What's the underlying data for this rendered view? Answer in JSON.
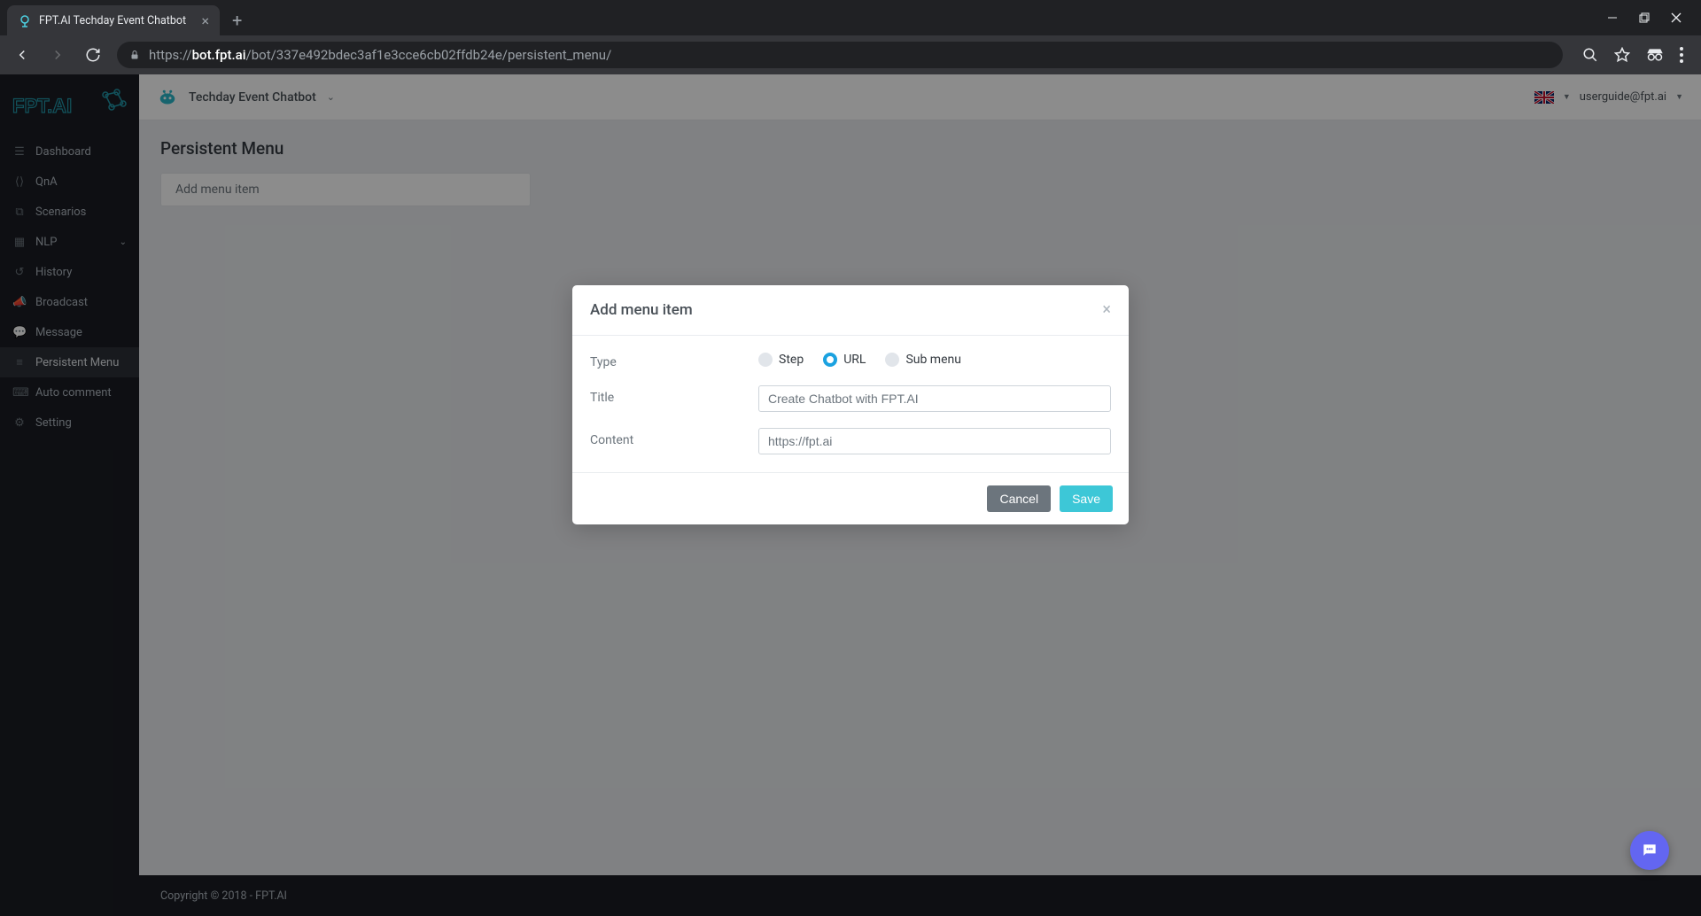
{
  "browser": {
    "tab_title": "FPT.AI Techday Event Chatbot",
    "url_scheme": "https://",
    "url_host": "bot.fpt.ai",
    "url_path": "/bot/337e492bdec3af1e3cce6cb02ffdb24e/persistent_menu/"
  },
  "sidebar": {
    "items": [
      {
        "label": "Dashboard"
      },
      {
        "label": "QnA"
      },
      {
        "label": "Scenarios"
      },
      {
        "label": "NLP"
      },
      {
        "label": "History"
      },
      {
        "label": "Broadcast"
      },
      {
        "label": "Message"
      },
      {
        "label": "Persistent Menu"
      },
      {
        "label": "Auto comment"
      },
      {
        "label": "Setting"
      }
    ]
  },
  "topbar": {
    "bot_name": "Techday Event Chatbot",
    "user_email": "userguide@fpt.ai"
  },
  "page": {
    "title": "Persistent Menu",
    "add_menu_placeholder": "Add menu item"
  },
  "modal": {
    "title": "Add menu item",
    "type_label": "Type",
    "title_label": "Title",
    "content_label": "Content",
    "radio_step": "Step",
    "radio_url": "URL",
    "radio_submenu": "Sub menu",
    "title_value": "Create Chatbot with FPT.AI",
    "content_value": "https://fpt.ai",
    "cancel": "Cancel",
    "save": "Save"
  },
  "footer": {
    "copyright": "Copyright © 2018 - FPT.AI"
  }
}
